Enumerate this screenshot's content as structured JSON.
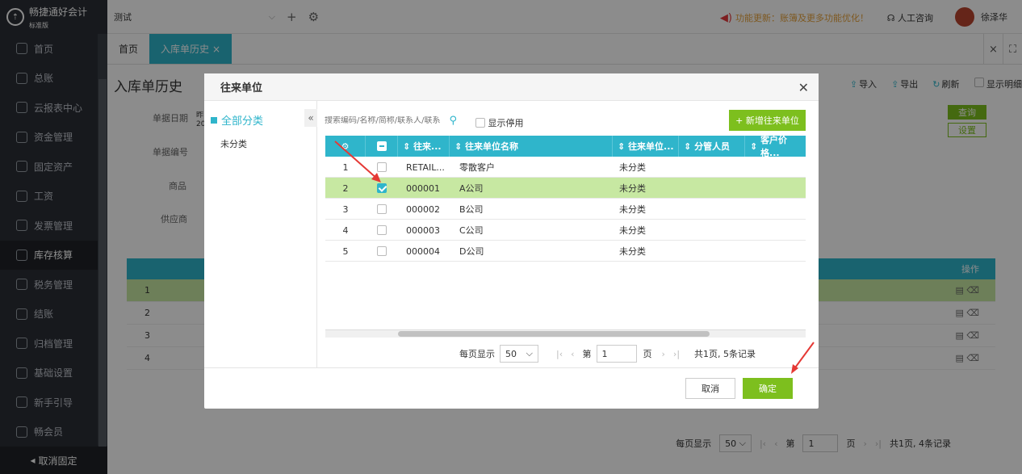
{
  "app": {
    "logo_text": "畅捷通好会计",
    "logo_sub": "标准版",
    "account": "测试"
  },
  "topbar": {
    "notice": "功能更新：账簿及更多功能优化！",
    "consult": "人工咨询",
    "user": "徐泽华"
  },
  "sidebar": {
    "items": [
      {
        "label": "首页"
      },
      {
        "label": "总账"
      },
      {
        "label": "云报表中心"
      },
      {
        "label": "资金管理"
      },
      {
        "label": "固定资产"
      },
      {
        "label": "工资"
      },
      {
        "label": "发票管理"
      },
      {
        "label": "库存核算"
      },
      {
        "label": "税务管理"
      },
      {
        "label": "结账"
      },
      {
        "label": "归档管理"
      },
      {
        "label": "基础设置"
      },
      {
        "label": "新手引导"
      },
      {
        "label": "畅会员"
      }
    ],
    "unfix": "取消固定"
  },
  "tabs": [
    {
      "label": "首页"
    },
    {
      "label": "入库单历史"
    }
  ],
  "page": {
    "title": "入库单历史",
    "labels": {
      "date": "单据日期",
      "number": "单据编号",
      "goods": "商品",
      "supplier": "供应商"
    },
    "date_value_partial": "昨 20",
    "query": "查询",
    "settings": "设置",
    "toolbar": {
      "import": "导入",
      "export": "导出",
      "refresh": "刷新",
      "show_detail": "显示明细"
    },
    "op_header": "操作",
    "rows": [
      "1",
      "2",
      "3",
      "4"
    ],
    "pager": {
      "per_page_label": "每页显示",
      "per_page": "50",
      "page_label": "第",
      "page": "1",
      "page_suffix": "页",
      "summary": "共1页, 4条记录"
    }
  },
  "modal": {
    "title": "往来单位",
    "categories": {
      "all": "全部分类",
      "sub": "未分类"
    },
    "search_placeholder": "搜索编码/名称/简称/联系人/联系",
    "show_disabled": "显示停用",
    "new_button": "+ 新增往来单位",
    "columns": [
      "往来...",
      "往来单位名称",
      "往来单位...",
      "分管人员",
      "客户价格..."
    ],
    "rows": [
      {
        "no": "1",
        "code": "RETAIL...",
        "name": "零散客户",
        "cat": "未分类",
        "checked": false
      },
      {
        "no": "2",
        "code": "000001",
        "name": "A公司",
        "cat": "未分类",
        "checked": true
      },
      {
        "no": "3",
        "code": "000002",
        "name": "B公司",
        "cat": "未分类",
        "checked": false
      },
      {
        "no": "4",
        "code": "000003",
        "name": "C公司",
        "cat": "未分类",
        "checked": false
      },
      {
        "no": "5",
        "code": "000004",
        "name": "D公司",
        "cat": "未分类",
        "checked": false
      }
    ],
    "pager": {
      "per_page_label": "每页显示",
      "per_page": "50",
      "page_label": "第",
      "page": "1",
      "page_suffix": "页",
      "summary": "共1页, 5条记录"
    },
    "cancel": "取消",
    "ok": "确定"
  },
  "colors": {
    "accent": "#2fb5cb",
    "green": "#7dbf1e",
    "selected_row": "#c7e8a2",
    "sidebar": "#2b2f36"
  }
}
